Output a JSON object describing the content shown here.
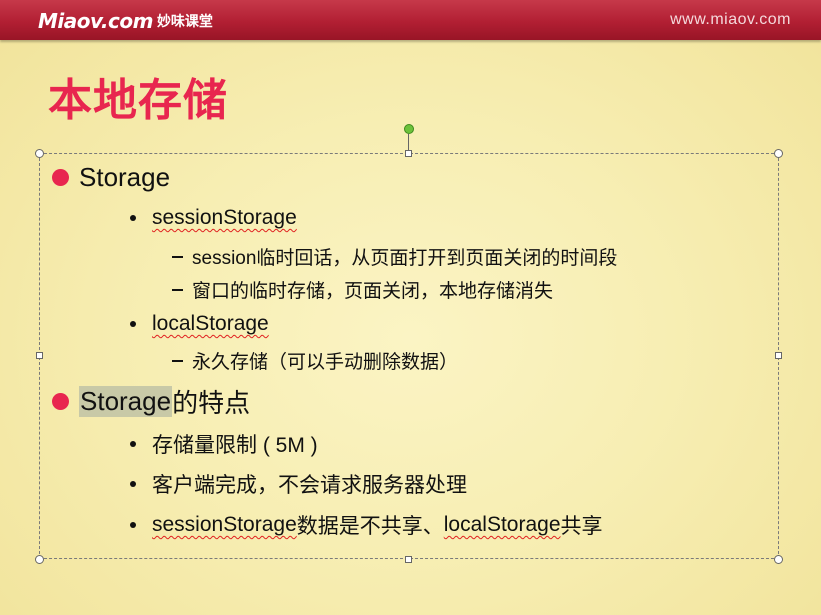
{
  "header": {
    "brand_logo": "Miaov.com",
    "brand_cn": "妙味课堂",
    "url": "www.miaov.com",
    "color": "#b21f33"
  },
  "slide": {
    "title": "本地存储",
    "accent_color": "#e8264f",
    "bullets": {
      "storage": "Storage",
      "session_storage": "sessionStorage",
      "session_desc_1": "session临时回话，从页面打开到页面关闭的时间段",
      "session_desc_2": "窗口的临时存储，页面关闭，本地存储消失",
      "local_storage": "localStorage",
      "local_desc_1": "永久存储（可以手动删除数据）",
      "features_highlight": "Storage",
      "features_rest": "的特点",
      "feature_1": "存储量限制 ( 5M )",
      "feature_2": "客户端完成，不会请求服务器处理",
      "feature_3_a": "sessionStorage",
      "feature_3_b": "数据是不共享、 ",
      "feature_3_c": "localStorage",
      "feature_3_d": "共享"
    }
  }
}
